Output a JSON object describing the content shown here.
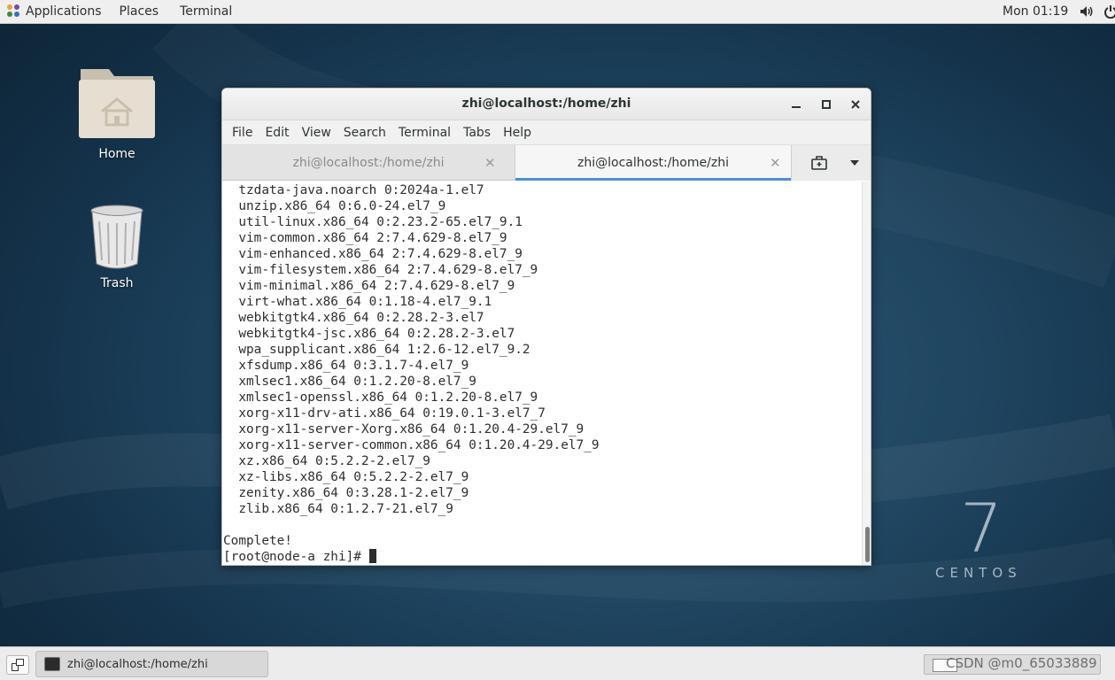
{
  "topbar": {
    "applications": "Applications",
    "places": "Places",
    "terminal": "Terminal",
    "clock": "Mon 01:19"
  },
  "desktop": {
    "home_label": "Home",
    "trash_label": "Trash",
    "logo_number": "7",
    "logo_word": "CENTOS"
  },
  "window": {
    "title": "zhi@localhost:/home/zhi",
    "menu": [
      "File",
      "Edit",
      "View",
      "Search",
      "Terminal",
      "Tabs",
      "Help"
    ],
    "tabs": [
      {
        "label": "zhi@localhost:/home/zhi",
        "active": false
      },
      {
        "label": "zhi@localhost:/home/zhi",
        "active": true
      }
    ],
    "terminal_lines": [
      "  tzdata-java.noarch 0:2024a-1.el7",
      "  unzip.x86_64 0:6.0-24.el7_9",
      "  util-linux.x86_64 0:2.23.2-65.el7_9.1",
      "  vim-common.x86_64 2:7.4.629-8.el7_9",
      "  vim-enhanced.x86_64 2:7.4.629-8.el7_9",
      "  vim-filesystem.x86_64 2:7.4.629-8.el7_9",
      "  vim-minimal.x86_64 2:7.4.629-8.el7_9",
      "  virt-what.x86_64 0:1.18-4.el7_9.1",
      "  webkitgtk4.x86_64 0:2.28.2-3.el7",
      "  webkitgtk4-jsc.x86_64 0:2.28.2-3.el7",
      "  wpa_supplicant.x86_64 1:2.6-12.el7_9.2",
      "  xfsdump.x86_64 0:3.1.7-4.el7_9",
      "  xmlsec1.x86_64 0:1.2.20-8.el7_9",
      "  xmlsec1-openssl.x86_64 0:1.2.20-8.el7_9",
      "  xorg-x11-drv-ati.x86_64 0:19.0.1-3.el7_7",
      "  xorg-x11-server-Xorg.x86_64 0:1.20.4-29.el7_9",
      "  xorg-x11-server-common.x86_64 0:1.20.4-29.el7_9",
      "  xz.x86_64 0:5.2.2-2.el7_9",
      "  xz-libs.x86_64 0:5.2.2-2.el7_9",
      "  zenity.x86_64 0:3.28.1-2.el7_9",
      "  zlib.x86_64 0:1.2.7-21.el7_9",
      "",
      "Complete!"
    ],
    "prompt": "[root@node-a zhi]# "
  },
  "taskbar": {
    "task_label": "zhi@localhost:/home/zhi"
  },
  "watermark": "CSDN @m0_65033889",
  "colors": {
    "tab_accent": "#4a90d9",
    "desktop_bg": "#1f4560"
  }
}
